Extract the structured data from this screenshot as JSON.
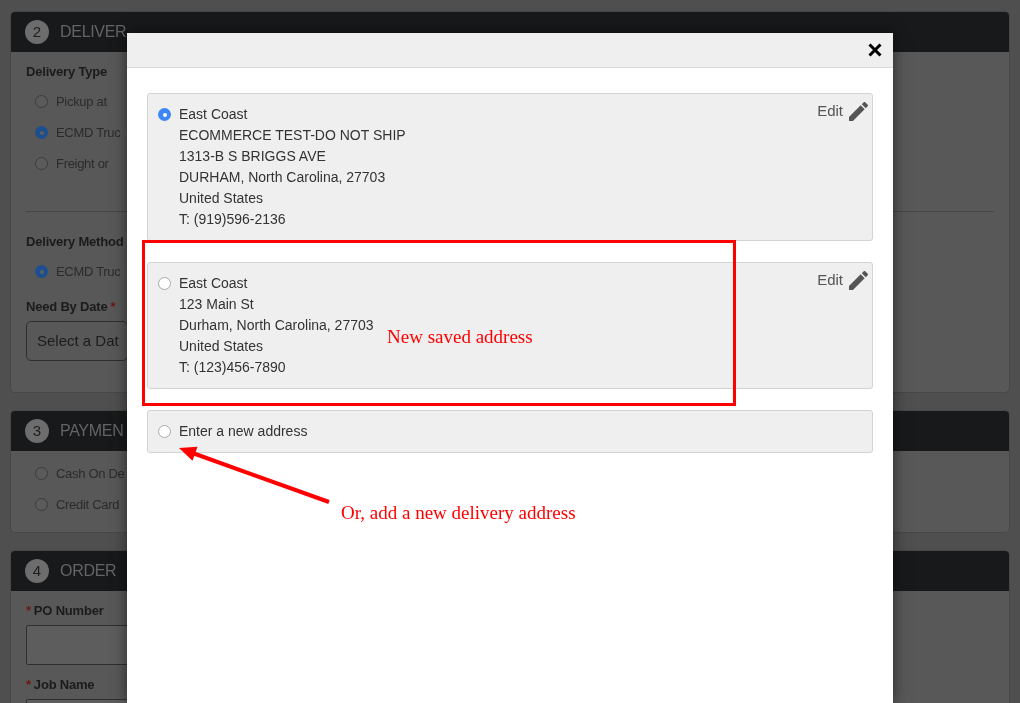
{
  "background_form": {
    "sections": [
      {
        "number": "2",
        "title": "DELIVER",
        "items": [
          {
            "kind": "label",
            "text": "Delivery Type"
          },
          {
            "kind": "radio",
            "label": "Pickup at",
            "selected": false
          },
          {
            "kind": "radio",
            "label": "ECMD Truc",
            "selected": true
          },
          {
            "kind": "radio",
            "label": "Freight or",
            "selected": false
          },
          {
            "kind": "divider"
          },
          {
            "kind": "label",
            "text": "Delivery Method"
          },
          {
            "kind": "radio",
            "label": "ECMD Truc",
            "selected": true
          },
          {
            "kind": "label",
            "text": "Need By Date",
            "required_mark": "*",
            "mark_first": false
          },
          {
            "kind": "select",
            "value": "Select a Dat"
          }
        ]
      },
      {
        "number": "3",
        "title": "PAYMEN",
        "items": [
          {
            "kind": "radio",
            "label": "Cash On De",
            "selected": false
          },
          {
            "kind": "radio",
            "label": "Credit Card",
            "selected": false
          }
        ]
      },
      {
        "number": "4",
        "title": "ORDER",
        "items": [
          {
            "kind": "label",
            "text": "PO Number",
            "required_mark": "*",
            "mark_first": true
          },
          {
            "kind": "input"
          },
          {
            "kind": "label",
            "text": "Job Name",
            "required_mark": "*",
            "mark_first": true
          },
          {
            "kind": "input"
          }
        ]
      }
    ]
  },
  "modal": {
    "addresses": [
      {
        "selected": true,
        "lines": [
          "East Coast",
          "ECOMMERCE TEST-DO NOT SHIP",
          "1313-B S BRIGGS AVE",
          "DURHAM, North Carolina, 27703",
          "United States",
          "T: (919)596-2136"
        ],
        "edit_label": "Edit"
      },
      {
        "selected": false,
        "lines": [
          "East Coast",
          "123 Main St",
          "Durham, North Carolina, 27703",
          "United States",
          "T: (123)456-7890"
        ],
        "edit_label": "Edit",
        "callout": {
          "kind": "highlight_box",
          "text": "New saved address"
        }
      },
      {
        "selected": false,
        "lines": [
          "Enter a new address"
        ],
        "callout": {
          "kind": "arrow_note",
          "text": "Or, add a new delivery address"
        }
      }
    ]
  }
}
